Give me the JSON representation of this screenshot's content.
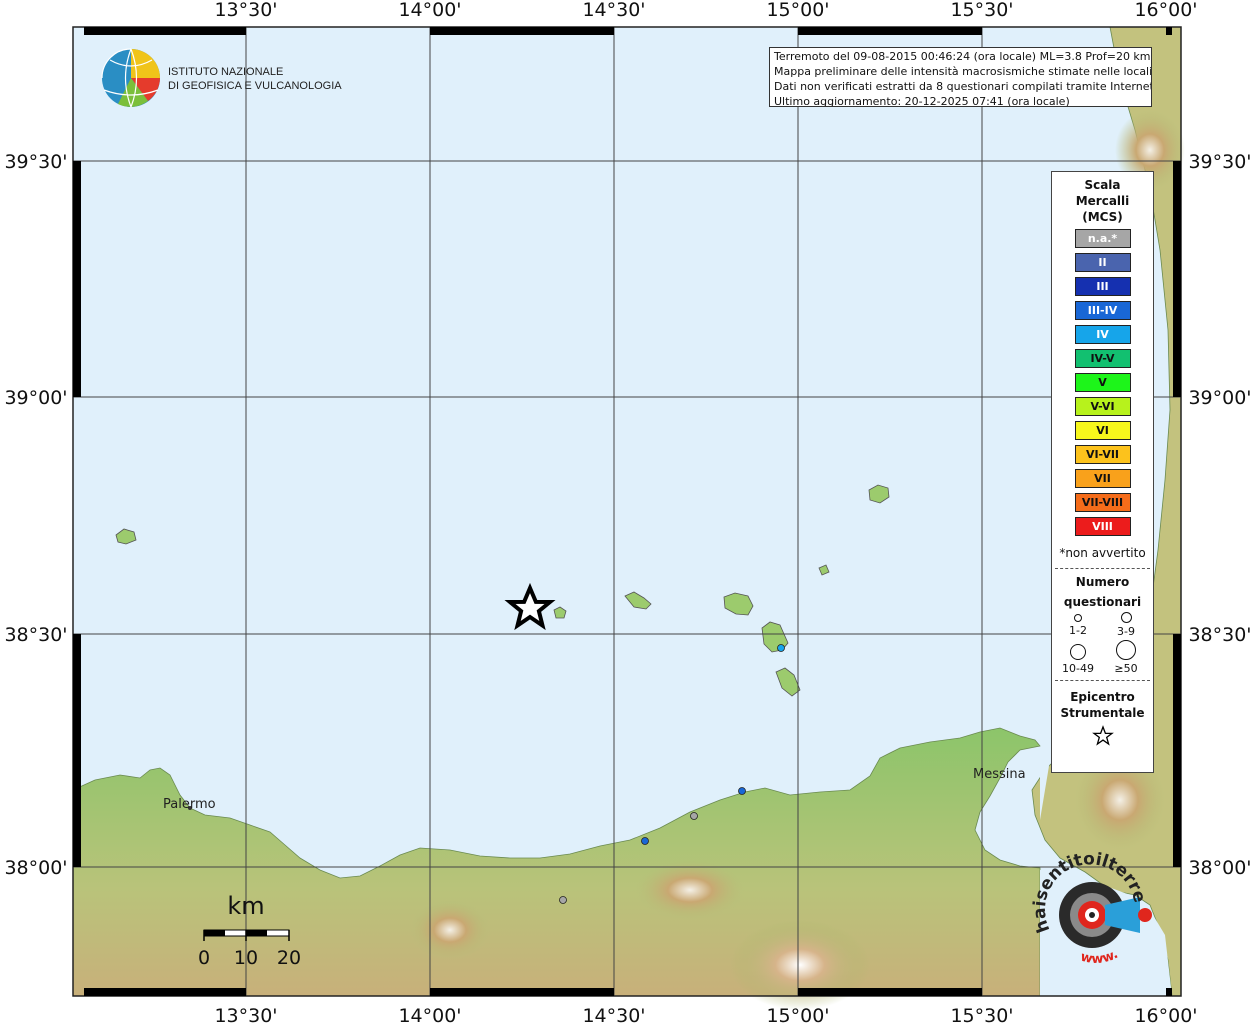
{
  "info": {
    "line1": "Terremoto del 09-08-2015 00:46:24 (ora locale) ML=3.8 Prof=20 km",
    "line2": "Mappa preliminare delle intensità macrosismiche stimate nelle località",
    "line3": "Dati non verificati estratti da 8 questionari compilati tramite Internet.",
    "line4": "Ultimo aggiornamento: 20-12-2025 07:41 (ora locale)"
  },
  "logo": {
    "line1": "ISTITUTO NAZIONALE",
    "line2": "DI GEOFISICA E VULCANOLOGIA"
  },
  "axes": {
    "top": [
      "13°30'",
      "14°00'",
      "14°30'",
      "15°00'",
      "15°30'",
      "16°00'"
    ],
    "bottom": [
      "13°30'",
      "14°00'",
      "14°30'",
      "15°00'",
      "15°30'",
      "16°00'"
    ],
    "left": [
      "39°30'",
      "39°00'",
      "38°30'",
      "38°00'"
    ],
    "right": [
      "39°30'",
      "39°00'",
      "38°30'",
      "38°00'"
    ]
  },
  "places": {
    "palermo": "Palermo",
    "messina": "Messina"
  },
  "legend": {
    "title1": "Scala",
    "title2": "Mercalli",
    "title3": "(MCS)",
    "scale": [
      {
        "label": "n.a.*",
        "color": "#a6a6a6",
        "text": "#ffffff"
      },
      {
        "label": "II",
        "color": "#4a64ae",
        "text": "#ffffff"
      },
      {
        "label": "III",
        "color": "#1530b0",
        "text": "#ffffff"
      },
      {
        "label": "III-IV",
        "color": "#1967d6",
        "text": "#ffffff"
      },
      {
        "label": "IV",
        "color": "#16a5ea",
        "text": "#ffffff"
      },
      {
        "label": "IV-V",
        "color": "#12c070",
        "text": "#111111"
      },
      {
        "label": "V",
        "color": "#1df51a",
        "text": "#111111"
      },
      {
        "label": "V-VI",
        "color": "#b7f21c",
        "text": "#111111"
      },
      {
        "label": "VI",
        "color": "#f7f71c",
        "text": "#111111"
      },
      {
        "label": "VI-VII",
        "color": "#fcc21c",
        "text": "#111111"
      },
      {
        "label": "VII",
        "color": "#f9a11b",
        "text": "#111111"
      },
      {
        "label": "VII-VIII",
        "color": "#f56c1a",
        "text": "#111111"
      },
      {
        "label": "VIII",
        "color": "#ec1c1c",
        "text": "#ffffff"
      }
    ],
    "footnote": "*non avvertito",
    "count_title1": "Numero",
    "count_title2": "questionari",
    "counts": [
      "1-2",
      "3-9",
      "10-49",
      "≥50"
    ],
    "epi_title1": "Epicentro",
    "epi_title2": "Strumentale"
  },
  "scale_bar": {
    "unit": "km",
    "labels": [
      "0",
      "10",
      "20"
    ]
  },
  "watermark": {
    "text1": "haisentitoilterremoto.it",
    "text2": "www."
  },
  "observations": [
    {
      "name": "dot-1",
      "intensity": "IV"
    },
    {
      "name": "dot-2",
      "intensity": "III"
    },
    {
      "name": "dot-3",
      "intensity": "n.a."
    },
    {
      "name": "dot-4",
      "intensity": "III"
    },
    {
      "name": "dot-5",
      "intensity": "n.a."
    }
  ]
}
